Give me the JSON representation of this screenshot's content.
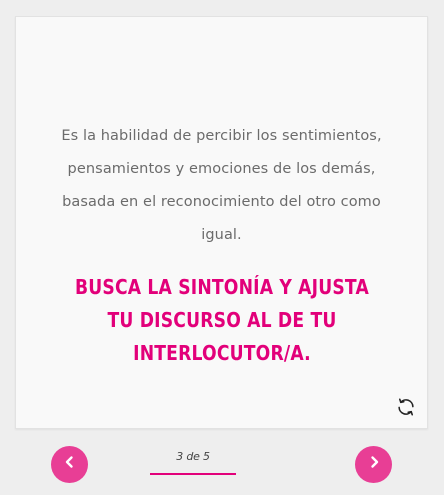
{
  "card": {
    "description": "Es la habilidad de percibir los sentimientos, pensamientos y emociones de los demás, basada en el reconocimiento del otro como igual.",
    "highlight": "BUSCA LA SINTONÍA Y AJUSTA TU DISCURSO AL DE TU INTERLOCUTOR/A.",
    "flip_icon": "refresh-icon"
  },
  "navigation": {
    "prev_icon": "chevron-left-icon",
    "next_icon": "chevron-right-icon",
    "pager_text": "3 de 5",
    "current_page": 3,
    "total_pages": 5
  },
  "colors": {
    "accent": "#e2007a",
    "button": "#e83e95",
    "background": "#eeeeee",
    "card": "#f9f9f9",
    "text": "#6b6b6b"
  }
}
